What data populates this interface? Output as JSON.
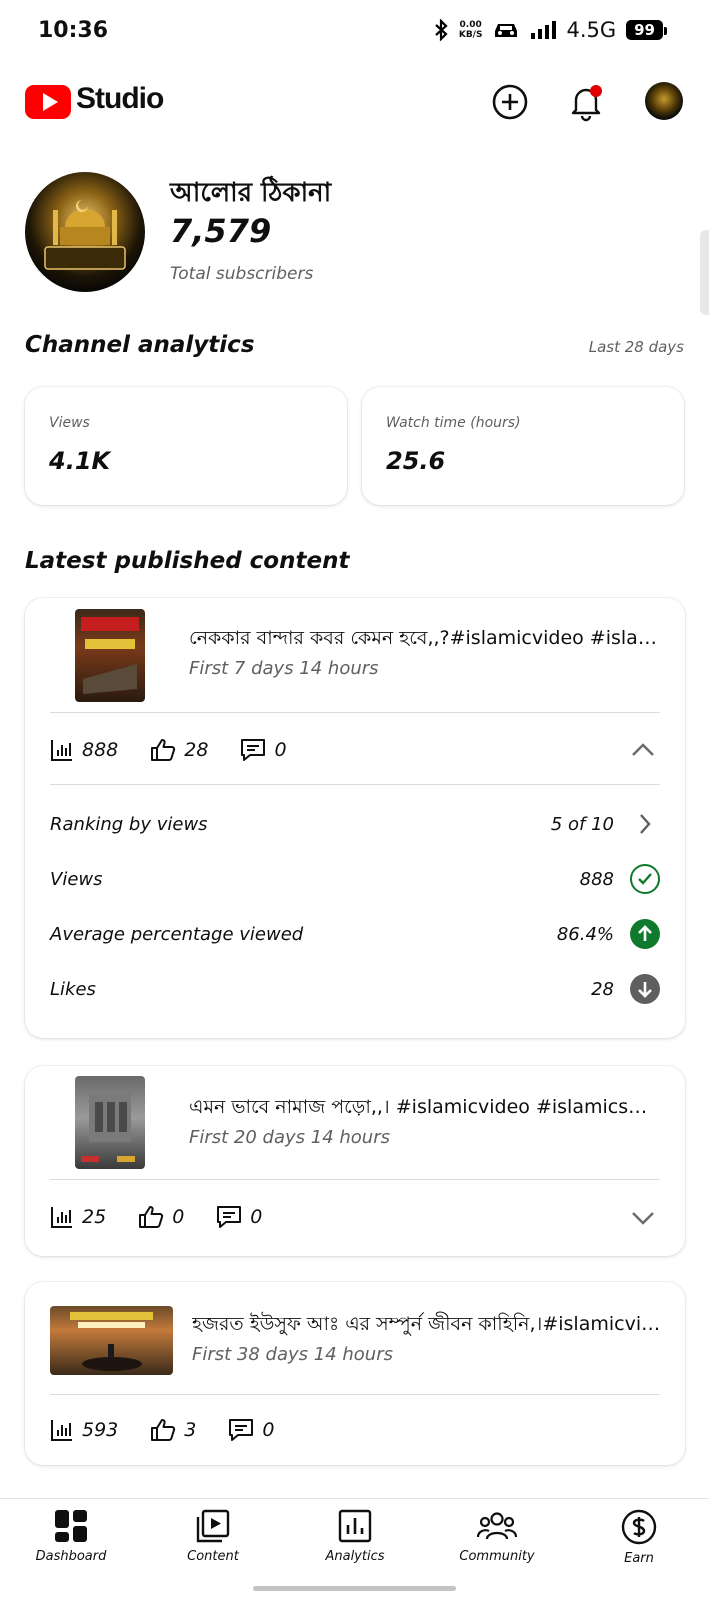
{
  "status_bar": {
    "time": "10:36",
    "net_speed_value": "0.00",
    "net_speed_unit": "KB/S",
    "network": "4.5G",
    "battery": "99"
  },
  "app_bar": {
    "brand": "Studio"
  },
  "channel": {
    "name": "আলোর ঠিকানা",
    "subscribers": "7,579",
    "subscribers_label": "Total subscribers"
  },
  "analytics": {
    "title": "Channel analytics",
    "period": "Last 28 days",
    "metrics": [
      {
        "label": "Views",
        "value": "4.1K"
      },
      {
        "label": "Watch time (hours)",
        "value": "25.6"
      }
    ]
  },
  "latest": {
    "title": "Latest published content",
    "videos": [
      {
        "title": "নেককার বান্দার কবর কেমন হবে,,?#islamicvideo #islamicshorts",
        "meta": "First 7 days 14 hours",
        "views": "888",
        "likes": "28",
        "comments": "0",
        "expanded": true,
        "details": [
          {
            "label": "Ranking by views",
            "value": "5 of 10",
            "icon": "chevron-right-icon"
          },
          {
            "label": "Views",
            "value": "888",
            "icon": "check-circle-icon"
          },
          {
            "label": "Average percentage viewed",
            "value": "86.4%",
            "icon": "arrow-up-circle-icon"
          },
          {
            "label": "Likes",
            "value": "28",
            "icon": "arrow-down-circle-icon"
          }
        ]
      },
      {
        "title": "এমন ভাবে নামাজ পড়ো,,। #islamicvideo #islamicshorts",
        "meta": "First 20 days 14 hours",
        "views": "25",
        "likes": "0",
        "comments": "0",
        "expanded": false
      },
      {
        "title": "হজরত ইউসুফ আঃ এর সম্পুর্ন জীবন কাহিনি,।#islamicvideo",
        "meta": "First 38 days 14 hours",
        "views": "593",
        "likes": "3",
        "comments": "0",
        "expanded": false
      }
    ]
  },
  "bottom_nav": {
    "items": [
      {
        "label": "Dashboard",
        "icon": "dashboard-icon"
      },
      {
        "label": "Content",
        "icon": "content-icon"
      },
      {
        "label": "Analytics",
        "icon": "analytics-icon"
      },
      {
        "label": "Community",
        "icon": "community-icon"
      },
      {
        "label": "Earn",
        "icon": "earn-icon"
      }
    ]
  },
  "colors": {
    "brand_red": "#ff0000",
    "notification_dot": "#e00000",
    "good_green": "#0f7a2d",
    "neutral_gray": "#5f5f5f"
  }
}
